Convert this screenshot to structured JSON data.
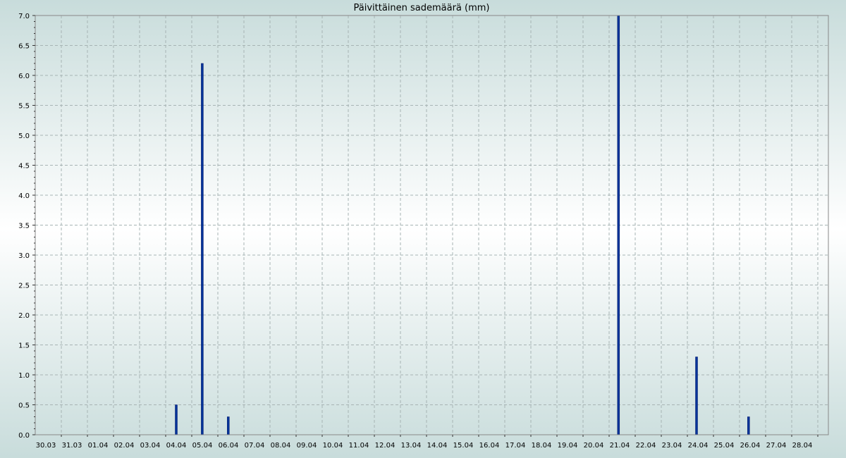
{
  "chart_data": {
    "type": "bar",
    "title": "Päivittäinen sademäärä (mm)",
    "xlabel": "",
    "ylabel": "",
    "categories": [
      "30.03",
      "31.03",
      "01.04",
      "02.04",
      "03.04",
      "04.04",
      "05.04",
      "06.04",
      "07.04",
      "08.04",
      "09.04",
      "10.04",
      "11.04",
      "12.04",
      "13.04",
      "14.04",
      "15.04",
      "16.04",
      "17.04",
      "18.04",
      "19.04",
      "20.04",
      "21.04",
      "22.04",
      "23.04",
      "24.04",
      "25.04",
      "26.04",
      "27.04",
      "28.04"
    ],
    "values": [
      0,
      0,
      0,
      0,
      0,
      0.5,
      6.2,
      0.3,
      0,
      0,
      0,
      0,
      0,
      0,
      0,
      0,
      0,
      0,
      0,
      0,
      0,
      0,
      7.0,
      0,
      0,
      1.3,
      0,
      0.3,
      0,
      0
    ],
    "ylim": [
      0,
      7.0
    ],
    "yticks": [
      "0.0",
      "0.5",
      "1.0",
      "1.5",
      "2.0",
      "2.5",
      "3.0",
      "3.5",
      "4.0",
      "4.5",
      "5.0",
      "5.5",
      "6.0",
      "6.5",
      "7.0"
    ],
    "grid": true,
    "colors": {
      "bar": "#003399",
      "bar_edge": "#0a1a6a",
      "grid": "#a7b4b4",
      "axis": "#777777"
    }
  }
}
